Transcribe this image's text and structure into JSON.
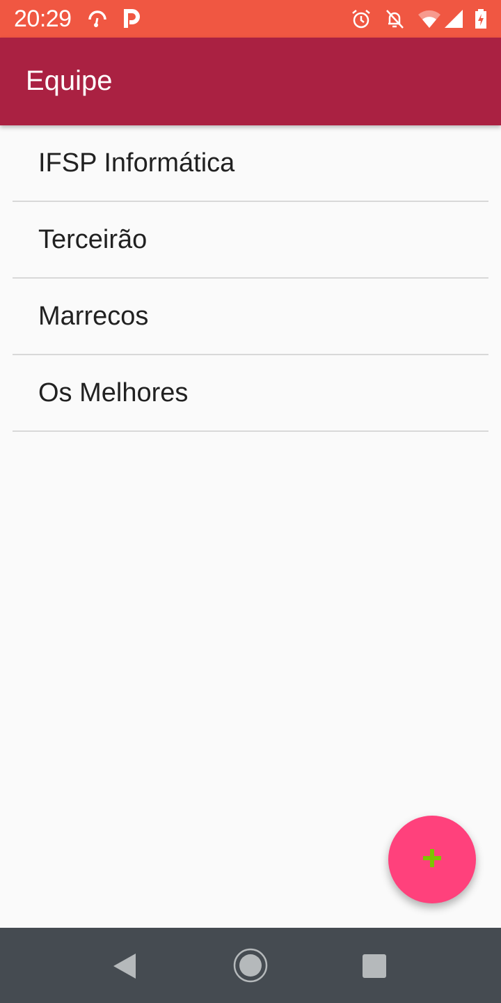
{
  "status_bar": {
    "time": "20:29",
    "icons": [
      "speedometer-icon",
      "parking-icon",
      "alarm-icon",
      "notifications-off-icon",
      "wifi-icon",
      "signal-icon",
      "battery-charging-icon"
    ]
  },
  "app_bar": {
    "title": "Equipe"
  },
  "teams": [
    {
      "name": "IFSP Informática"
    },
    {
      "name": "Terceirão"
    },
    {
      "name": "Marrecos"
    },
    {
      "name": "Os Melhores"
    }
  ],
  "fab": {
    "icon": "plus-icon",
    "color": "#ff417c",
    "icon_color": "#7cc400"
  },
  "colors": {
    "status_bar": "#f05742",
    "app_bar": "#aa2142",
    "nav_bar": "#454b51"
  },
  "nav_bar": {
    "buttons": [
      "back-icon",
      "home-icon",
      "recents-icon"
    ]
  }
}
